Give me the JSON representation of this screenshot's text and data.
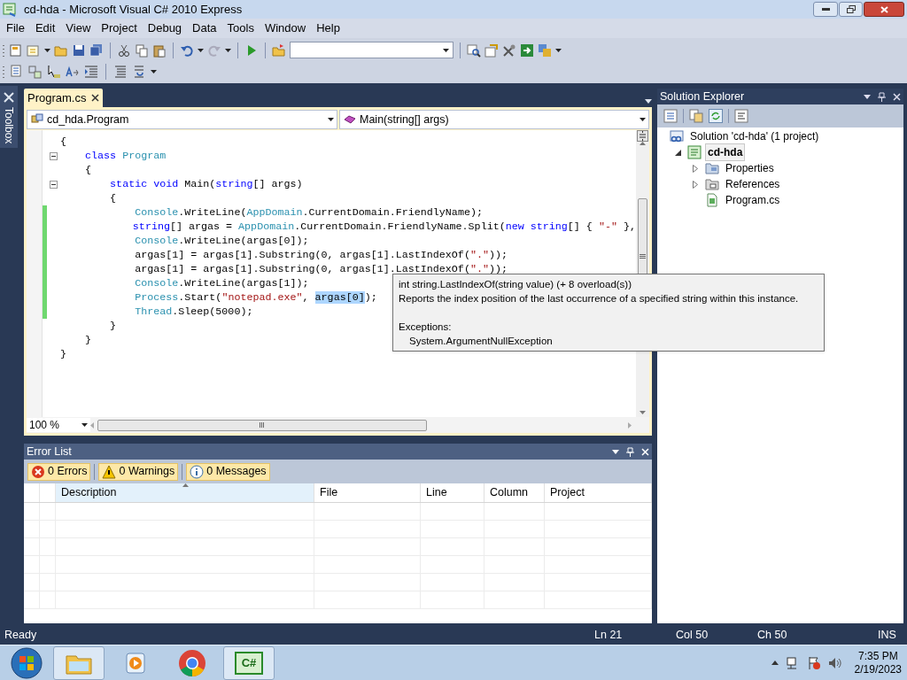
{
  "window": {
    "title": "cd-hda - Microsoft Visual C# 2010 Express"
  },
  "menu": [
    "File",
    "Edit",
    "View",
    "Project",
    "Debug",
    "Data",
    "Tools",
    "Window",
    "Help"
  ],
  "toolbox": {
    "label": "Toolbox"
  },
  "editor": {
    "tabs": [
      {
        "label": "Program.cs",
        "selected": true
      }
    ],
    "type_dropdown": "cd_hda.Program",
    "member_dropdown": "Main(string[] args)",
    "lines": [
      {
        "changed": false,
        "foldable": false,
        "tokens": [
          {
            "kind": "plain",
            "text": "{"
          }
        ]
      },
      {
        "changed": false,
        "foldable": true,
        "tokens": [
          {
            "kind": "keyword",
            "text": "    class "
          },
          {
            "kind": "type",
            "text": "Program"
          }
        ]
      },
      {
        "changed": false,
        "foldable": false,
        "tokens": [
          {
            "kind": "plain",
            "text": "    {"
          }
        ]
      },
      {
        "changed": false,
        "foldable": true,
        "tokens": [
          {
            "kind": "keyword",
            "text": "        static void"
          },
          {
            "kind": "plain",
            "text": " Main("
          },
          {
            "kind": "keyword",
            "text": "string"
          },
          {
            "kind": "plain",
            "text": "[] args)"
          }
        ]
      },
      {
        "changed": false,
        "foldable": false,
        "tokens": [
          {
            "kind": "plain",
            "text": "        {"
          }
        ]
      },
      {
        "changed": true,
        "foldable": false,
        "tokens": [
          {
            "kind": "type",
            "text": "            Console"
          },
          {
            "kind": "plain",
            "text": ".WriteLine("
          },
          {
            "kind": "type",
            "text": "AppDomain"
          },
          {
            "kind": "plain",
            "text": ".CurrentDomain.FriendlyName);"
          }
        ]
      },
      {
        "changed": true,
        "foldable": false,
        "tokens": [
          {
            "kind": "keyword",
            "text": "            string"
          },
          {
            "kind": "plain",
            "text": "[] argas = "
          },
          {
            "kind": "type",
            "text": "AppDomain"
          },
          {
            "kind": "plain",
            "text": ".CurrentDomain.FriendlyName.Split("
          },
          {
            "kind": "keyword",
            "text": "new string"
          },
          {
            "kind": "plain",
            "text": "[] { "
          },
          {
            "kind": "string",
            "text": "\"-\""
          },
          {
            "kind": "plain",
            "text": " },"
          }
        ]
      },
      {
        "changed": true,
        "foldable": false,
        "tokens": [
          {
            "kind": "type",
            "text": "            Console"
          },
          {
            "kind": "plain",
            "text": ".WriteLine(argas[0]);"
          }
        ]
      },
      {
        "changed": true,
        "foldable": false,
        "tokens": [
          {
            "kind": "plain",
            "text": "            argas[1] = argas[1].Substring(0, argas[1].LastIndexOf("
          },
          {
            "kind": "string",
            "text": "\".\""
          },
          {
            "kind": "plain",
            "text": "));"
          }
        ]
      },
      {
        "changed": true,
        "foldable": false,
        "tokens": [
          {
            "kind": "plain",
            "text": "            argas[1] = argas[1].Substring(0, argas[1].LastIndexOf("
          },
          {
            "kind": "string",
            "text": "\".\""
          },
          {
            "kind": "plain",
            "text": "));"
          }
        ]
      },
      {
        "changed": true,
        "foldable": false,
        "tokens": [
          {
            "kind": "type",
            "text": "            Console"
          },
          {
            "kind": "plain",
            "text": ".WriteLine(argas[1]);"
          }
        ]
      },
      {
        "changed": true,
        "foldable": false,
        "tokens": [
          {
            "kind": "type",
            "text": "            Process"
          },
          {
            "kind": "plain",
            "text": ".Start("
          },
          {
            "kind": "string",
            "text": "\"notepad.exe\""
          },
          {
            "kind": "plain",
            "text": ", "
          },
          {
            "kind": "selection",
            "text": "argas[0]"
          },
          {
            "kind": "plain",
            "text": ");"
          }
        ]
      },
      {
        "changed": true,
        "foldable": false,
        "tokens": [
          {
            "kind": "type",
            "text": "            Thread"
          },
          {
            "kind": "plain",
            "text": ".Sleep(5000);"
          }
        ]
      },
      {
        "changed": false,
        "foldable": false,
        "tokens": [
          {
            "kind": "plain",
            "text": "        }"
          }
        ]
      },
      {
        "changed": false,
        "foldable": false,
        "tokens": [
          {
            "kind": "plain",
            "text": "    }"
          }
        ]
      },
      {
        "changed": false,
        "foldable": false,
        "tokens": [
          {
            "kind": "plain",
            "text": "}"
          }
        ]
      }
    ],
    "zoom": "100 %",
    "tooltip": {
      "signature": "int string.LastIndexOf(string value)  (+ 8 overload(s))",
      "description": "Reports the index position of the last occurrence of a specified string within this instance.",
      "exceptions_label": "Exceptions:",
      "exceptions": [
        "System.ArgumentNullException"
      ]
    }
  },
  "error_list": {
    "title": "Error List",
    "filters": [
      {
        "kind": "error",
        "label": "0 Errors",
        "selected": true
      },
      {
        "kind": "warning",
        "label": "0 Warnings",
        "selected": true
      },
      {
        "kind": "message",
        "label": "0 Messages",
        "selected": true
      }
    ],
    "columns": [
      "Description",
      "File",
      "Line",
      "Column",
      "Project"
    ]
  },
  "solution_explorer": {
    "title": "Solution Explorer",
    "tree": [
      {
        "kind": "solution",
        "label": "Solution 'cd-hda' (1 project)",
        "selected": false,
        "children": [
          {
            "kind": "project",
            "label": "cd-hda",
            "selected": true,
            "expanded": true,
            "children": [
              {
                "kind": "properties",
                "label": "Properties",
                "selected": false,
                "expanded": false
              },
              {
                "kind": "references",
                "label": "References",
                "selected": false,
                "expanded": false
              },
              {
                "kind": "file",
                "label": "Program.cs",
                "selected": false
              }
            ]
          }
        ]
      }
    ]
  },
  "status_bar": {
    "message": "Ready",
    "line": "Ln 21",
    "col": "Col 50",
    "ch": "Ch 50",
    "mode": "INS"
  },
  "taskbar": {
    "apps": [
      {
        "kind": "explorer",
        "open": true
      },
      {
        "kind": "media",
        "open": false
      },
      {
        "kind": "browser",
        "open": false
      },
      {
        "kind": "ide",
        "open": true,
        "glyph": "C#"
      }
    ],
    "time": "7:35 PM",
    "date": "2/19/2023"
  }
}
